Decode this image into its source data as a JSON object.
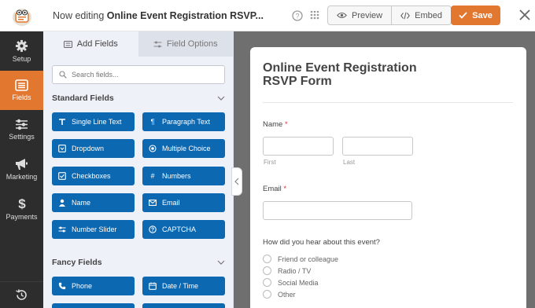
{
  "header": {
    "title_prefix": "Now editing ",
    "title_form": "Online Event Registration RSVP...",
    "preview_label": "Preview",
    "embed_label": "Embed",
    "save_label": "Save"
  },
  "rail": {
    "items": [
      {
        "label": "Setup",
        "icon": "gear-icon"
      },
      {
        "label": "Fields",
        "icon": "fields-icon"
      },
      {
        "label": "Settings",
        "icon": "sliders-icon"
      },
      {
        "label": "Marketing",
        "icon": "megaphone-icon"
      },
      {
        "label": "Payments",
        "icon": "dollar-icon"
      }
    ]
  },
  "panel": {
    "tabs": {
      "add_fields": "Add Fields",
      "field_options": "Field Options"
    },
    "search_placeholder": "Search fields...",
    "standard_title": "Standard Fields",
    "standard_fields": [
      {
        "label": "Single Line Text",
        "icon": "text-icon"
      },
      {
        "label": "Paragraph Text",
        "icon": "paragraph-icon"
      },
      {
        "label": "Dropdown",
        "icon": "dropdown-icon"
      },
      {
        "label": "Multiple Choice",
        "icon": "radio-icon"
      },
      {
        "label": "Checkboxes",
        "icon": "checkbox-icon"
      },
      {
        "label": "Numbers",
        "icon": "hash-icon"
      },
      {
        "label": "Name",
        "icon": "user-icon"
      },
      {
        "label": "Email",
        "icon": "envelope-icon"
      },
      {
        "label": "Number Slider",
        "icon": "slider-icon"
      },
      {
        "label": "CAPTCHA",
        "icon": "question-icon"
      }
    ],
    "fancy_title": "Fancy Fields",
    "fancy_fields": [
      {
        "label": "Phone",
        "icon": "phone-icon"
      },
      {
        "label": "Date / Time",
        "icon": "calendar-icon"
      }
    ]
  },
  "form": {
    "title": "Online Event Registration RSVP Form",
    "title_line1": "Online Event Registration",
    "title_line2": "RSVP Form",
    "name_label": "Name",
    "required_mark": "*",
    "first_label": "First",
    "last_label": "Last",
    "email_label": "Email",
    "question": "How did you hear about this event?",
    "options": [
      "Friend or colleague",
      "Radio / TV",
      "Social Media",
      "Other"
    ]
  },
  "colors": {
    "accent": "#e27730",
    "field_button": "#0d68b2",
    "rail_bg": "#2d2d2d",
    "panel_bg": "#eef1f8",
    "preview_bg": "#6f6f6f"
  }
}
